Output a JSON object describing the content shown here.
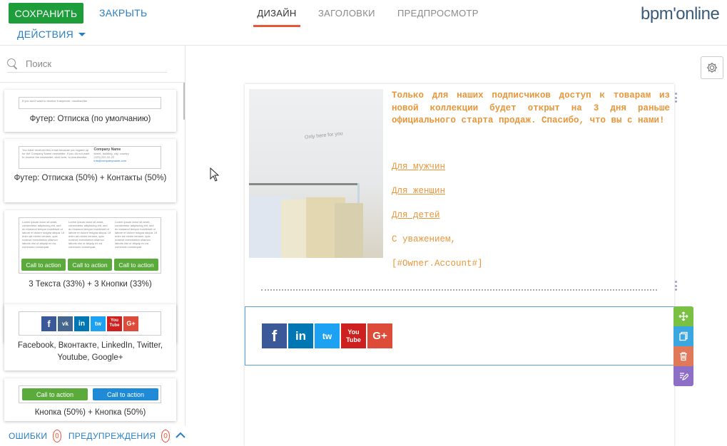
{
  "toolbar": {
    "save_label": "СОХРАНИТЬ",
    "close_label": "ЗАКРЫТЬ",
    "actions_label": "ДЕЙСТВИЯ"
  },
  "tabs": [
    {
      "label": "ДИЗАЙН",
      "active": true
    },
    {
      "label": "ЗАГОЛОВКИ",
      "active": false
    },
    {
      "label": "ПРЕДПРОСМОТР",
      "active": false
    }
  ],
  "logo": "bpm'online",
  "sidebar": {
    "search_placeholder": "Поиск",
    "blocks": [
      {
        "caption": "Футер: Отписка (по умолчанию)",
        "preview_text": "If you don't want to receive it anymore, unsubscribe"
      },
      {
        "caption": "Футер: Отписка (50%) + Контакты (50%)",
        "preview_left": "You have received this email because you signed up for the Company Name newsletter. If you do not want to receive the newsletter, click here, to unsubscribe.",
        "company": "Company Name",
        "address": "street, building, city, country",
        "phone": "(123) 222-22-22",
        "email": "info@companyname.com"
      },
      {
        "caption": "3 Текста (33%) + 3 Кнопки (33%)",
        "lorem": "Lorem ipsum dolor sit amet, consectetur adipiscing elit, sed do eiusmod tempor incididunt ut labore et dolore magna aliqua. Ut enim ad minim veniam, quis nostrud exercitation ullamco laboris nisi ut aliquip ex ea commodo consequat.",
        "cta_label": "Call to action"
      },
      {
        "caption": "Facebook, Вконтакте, LinkedIn, Twitter, Youtube, Google+"
      },
      {
        "caption": "Кнопка (50%) + Кнопка (50%)",
        "cta_label": "Call to action"
      }
    ]
  },
  "status": {
    "errors_label": "ОШИБКИ",
    "errors_count": "0",
    "warnings_label": "ПРЕДУПРЕЖДЕНИЯ",
    "warnings_count": "0"
  },
  "email": {
    "body": "Только для наших подписчиков доступ к товарам из новой коллекции будет открыт на 3 дня раньше официального старта продаж. Спасибо, что вы с нами!",
    "links": [
      "Для мужчин",
      "Для женщин",
      "Для детей"
    ],
    "regards": "С уважением,",
    "signature": "[#Owner.Account#]",
    "photo_sign": "Only here for you"
  },
  "social_icons": {
    "facebook": "f",
    "vk": "vk",
    "linkedin": "in",
    "twitter": "tw",
    "youtube_top": "You",
    "youtube_bottom": "Tube",
    "google_plus": "G+"
  },
  "colors": {
    "save": "#1e9e3a",
    "link": "#2a7fc4",
    "accent": "#e8573a",
    "email_text": "#e8963a",
    "facebook": "#3b5998",
    "linkedin": "#0077b5",
    "twitter": "#1da1f2",
    "youtube": "#cd201f",
    "google": "#dd4b39"
  },
  "icons": [
    "search-icon",
    "gear-icon",
    "chevron-down-icon",
    "chevron-up-icon",
    "move-icon",
    "copy-icon",
    "trash-icon",
    "edit-icon"
  ]
}
